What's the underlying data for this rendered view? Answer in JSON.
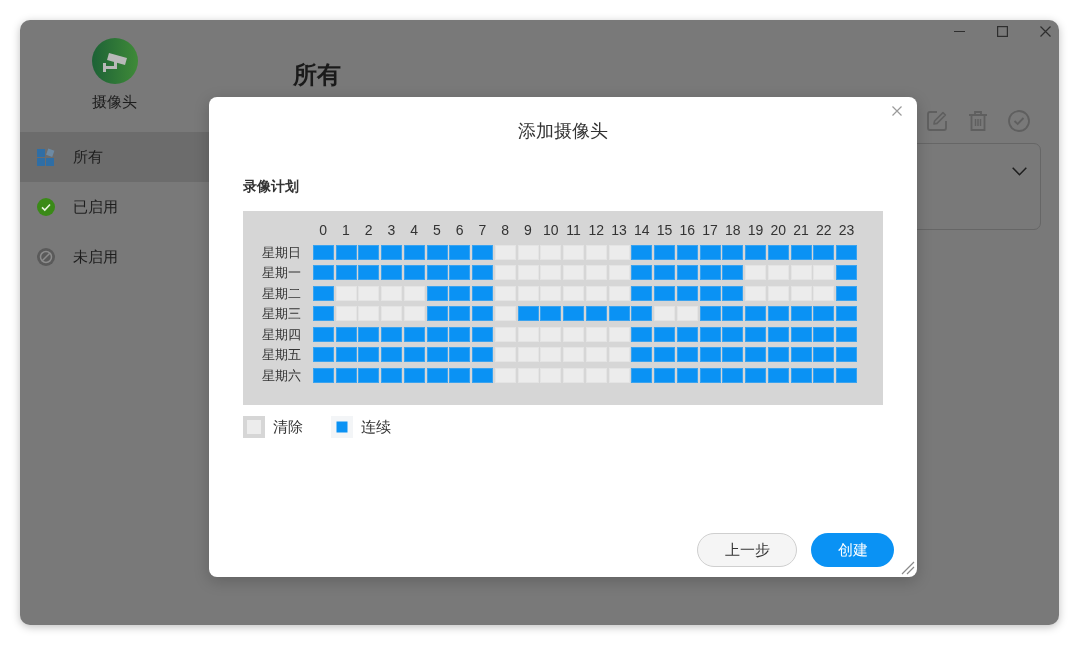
{
  "sidebar": {
    "app_name": "摄像头",
    "items": [
      {
        "kind": "all",
        "label": "所有",
        "selected": true
      },
      {
        "kind": "enabled",
        "label": "已启用",
        "selected": false
      },
      {
        "kind": "disabled",
        "label": "未启用",
        "selected": false
      }
    ]
  },
  "main": {
    "title": "所有"
  },
  "dialog": {
    "title": "添加摄像头",
    "section_title": "录像计划",
    "schedule": {
      "hours": [
        "0",
        "1",
        "2",
        "3",
        "4",
        "5",
        "6",
        "7",
        "8",
        "9",
        "10",
        "11",
        "12",
        "13",
        "14",
        "15",
        "16",
        "17",
        "18",
        "19",
        "20",
        "21",
        "22",
        "23"
      ],
      "days": [
        {
          "label": "星期日",
          "slots": [
            true,
            true,
            true,
            true,
            true,
            true,
            true,
            true,
            false,
            false,
            false,
            false,
            false,
            false,
            true,
            true,
            true,
            true,
            true,
            true,
            true,
            true,
            true,
            true
          ]
        },
        {
          "label": "星期一",
          "slots": [
            true,
            true,
            true,
            true,
            true,
            true,
            true,
            true,
            false,
            false,
            false,
            false,
            false,
            false,
            true,
            true,
            true,
            true,
            true,
            false,
            false,
            false,
            false,
            true
          ]
        },
        {
          "label": "星期二",
          "slots": [
            true,
            false,
            false,
            false,
            false,
            true,
            true,
            true,
            false,
            false,
            false,
            false,
            false,
            false,
            true,
            true,
            true,
            true,
            true,
            false,
            false,
            false,
            false,
            true
          ]
        },
        {
          "label": "星期三",
          "slots": [
            true,
            false,
            false,
            false,
            false,
            true,
            true,
            true,
            false,
            true,
            true,
            true,
            true,
            true,
            true,
            false,
            false,
            true,
            true,
            true,
            true,
            true,
            true,
            true
          ]
        },
        {
          "label": "星期四",
          "slots": [
            true,
            true,
            true,
            true,
            true,
            true,
            true,
            true,
            false,
            false,
            false,
            false,
            false,
            false,
            true,
            true,
            true,
            true,
            true,
            true,
            true,
            true,
            true,
            true
          ]
        },
        {
          "label": "星期五",
          "slots": [
            true,
            true,
            true,
            true,
            true,
            true,
            true,
            true,
            false,
            false,
            false,
            false,
            false,
            false,
            true,
            true,
            true,
            true,
            true,
            true,
            true,
            true,
            true,
            true
          ]
        },
        {
          "label": "星期六",
          "slots": [
            true,
            true,
            true,
            true,
            true,
            true,
            true,
            true,
            false,
            false,
            false,
            false,
            false,
            false,
            true,
            true,
            true,
            true,
            true,
            true,
            true,
            true,
            true,
            true
          ]
        }
      ]
    },
    "legend": [
      {
        "kind": "clear",
        "label": "清除"
      },
      {
        "kind": "continuous",
        "label": "连续"
      }
    ],
    "buttons": [
      {
        "kind": "secondary",
        "label": "上一步"
      },
      {
        "kind": "primary",
        "label": "创建"
      }
    ]
  }
}
